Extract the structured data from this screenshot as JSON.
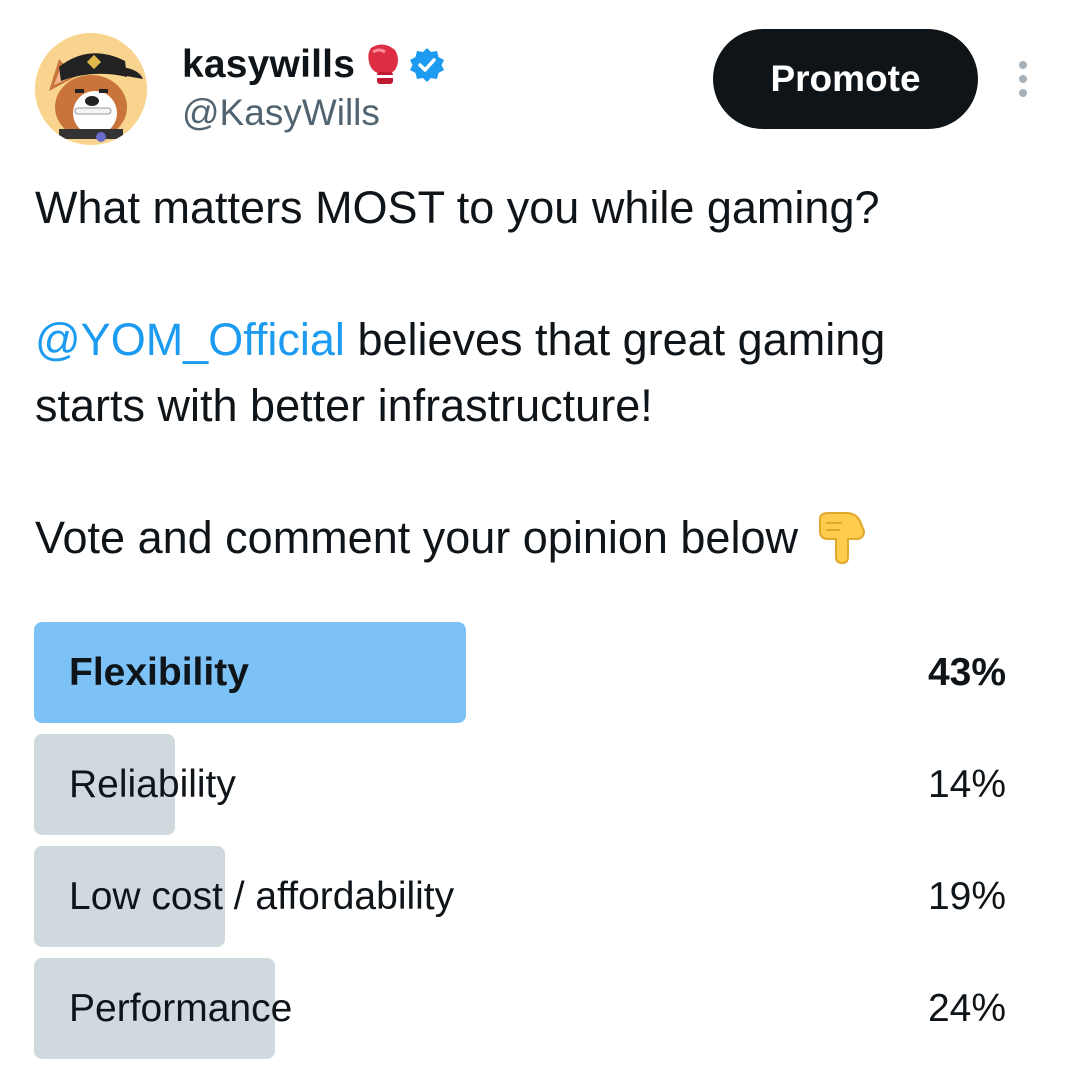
{
  "author": {
    "display_name": "kasywills",
    "handle": "@KasyWills",
    "name_emoji_icon": "boxing-glove-icon",
    "verified_icon": "verified-badge-icon",
    "verified_color": "#1d9bf0",
    "avatar_icon": "cartoon-dog-with-cap-avatar"
  },
  "actions": {
    "promote_label": "Promote",
    "more_icon": "more-vertical-icon"
  },
  "tweet": {
    "line1": "What matters MOST to you while gaming?",
    "mention": "@YOM_Official",
    "line2_rest": " believes that great gaming",
    "line3": "starts with better infrastructure!",
    "line4": "Vote and comment your opinion below ",
    "line4_emoji_icon": "backhand-index-pointing-down-icon"
  },
  "poll": {
    "options": [
      {
        "label": "Flexibility",
        "percent": "43%",
        "value": 43,
        "winner": true
      },
      {
        "label": "Reliability",
        "percent": "14%",
        "value": 14,
        "winner": false
      },
      {
        "label": "Low cost / affordability",
        "percent": "19%",
        "value": 19,
        "winner": false
      },
      {
        "label": "Performance",
        "percent": "24%",
        "value": 24,
        "winner": false
      }
    ]
  },
  "colors": {
    "winner_bar": "#7cc2f6",
    "other_bar": "#cfd9de",
    "mention": "#1d9bf0",
    "text": "#0f1419",
    "secondary_text": "#536471"
  }
}
